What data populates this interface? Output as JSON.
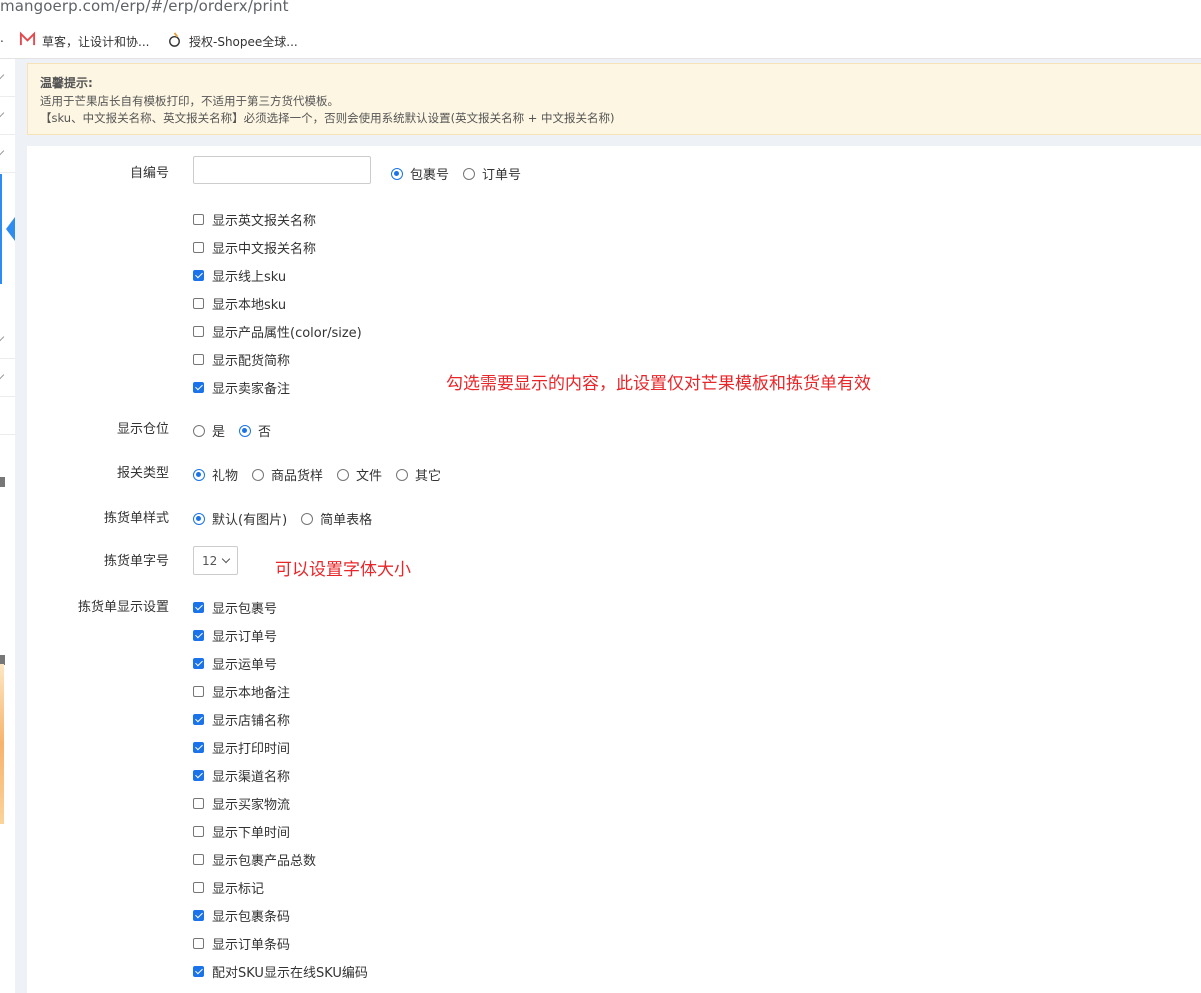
{
  "browser": {
    "url": "mangoerp.com/erp/#/erp/orderx/print",
    "bookmarks": [
      {
        "label": "草客，让设计和协...",
        "icon": "m-logo-icon"
      },
      {
        "label": "授权-Shopee全球...",
        "icon": "shopee-icon"
      }
    ],
    "bookmark_prefix": "."
  },
  "notice": {
    "title": "温馨提示:",
    "line1": "适用于芒果店长自有模板打印，不适用于第三方货代模板。",
    "line2": "【sku、中文报关名称、英文报关名称】必须选择一个，否则会使用系统默认设置(英文报关名称 + 中文报关名称)"
  },
  "form": {
    "self_number": {
      "label": "自编号",
      "value": "",
      "options": [
        {
          "label": "包裹号",
          "checked": true
        },
        {
          "label": "订单号",
          "checked": false
        }
      ]
    },
    "display_options": [
      {
        "label": "显示英文报关名称",
        "checked": false
      },
      {
        "label": "显示中文报关名称",
        "checked": false
      },
      {
        "label": "显示线上sku",
        "checked": true
      },
      {
        "label": "显示本地sku",
        "checked": false
      },
      {
        "label": "显示产品属性(color/size)",
        "checked": false
      },
      {
        "label": "显示配货简称",
        "checked": false
      },
      {
        "label": "显示卖家备注",
        "checked": true
      }
    ],
    "show_location": {
      "label": "显示仓位",
      "options": [
        {
          "label": "是",
          "checked": false
        },
        {
          "label": "否",
          "checked": true
        }
      ]
    },
    "customs_type": {
      "label": "报关类型",
      "options": [
        {
          "label": "礼物",
          "checked": true
        },
        {
          "label": "商品货样",
          "checked": false
        },
        {
          "label": "文件",
          "checked": false
        },
        {
          "label": "其它",
          "checked": false
        }
      ]
    },
    "picking_style": {
      "label": "拣货单样式",
      "options": [
        {
          "label": "默认(有图片)",
          "checked": true
        },
        {
          "label": "简单表格",
          "checked": false
        }
      ]
    },
    "picking_font": {
      "label": "拣货单字号",
      "value": "12"
    },
    "picking_display": {
      "label": "拣货单显示设置",
      "options": [
        {
          "label": "显示包裹号",
          "checked": true
        },
        {
          "label": "显示订单号",
          "checked": true
        },
        {
          "label": "显示运单号",
          "checked": true
        },
        {
          "label": "显示本地备注",
          "checked": false
        },
        {
          "label": "显示店铺名称",
          "checked": true
        },
        {
          "label": "显示打印时间",
          "checked": true
        },
        {
          "label": "显示渠道名称",
          "checked": true
        },
        {
          "label": "显示买家物流",
          "checked": false
        },
        {
          "label": "显示下单时间",
          "checked": false
        },
        {
          "label": "显示包裹产品总数",
          "checked": false
        },
        {
          "label": "显示标记",
          "checked": false
        },
        {
          "label": "显示包裹条码",
          "checked": true
        },
        {
          "label": "显示订单条码",
          "checked": false
        },
        {
          "label": "配对SKU显示在线SKU编码",
          "checked": true
        }
      ]
    }
  },
  "annotations": {
    "display_note": "勾选需要显示的内容，此设置仅对芒果模板和拣货单有效",
    "font_note": "可以设置字体大小"
  },
  "colors": {
    "accent": "#1a73e8",
    "annotation": "#e8262a",
    "notice_bg": "#fdf6e3"
  }
}
